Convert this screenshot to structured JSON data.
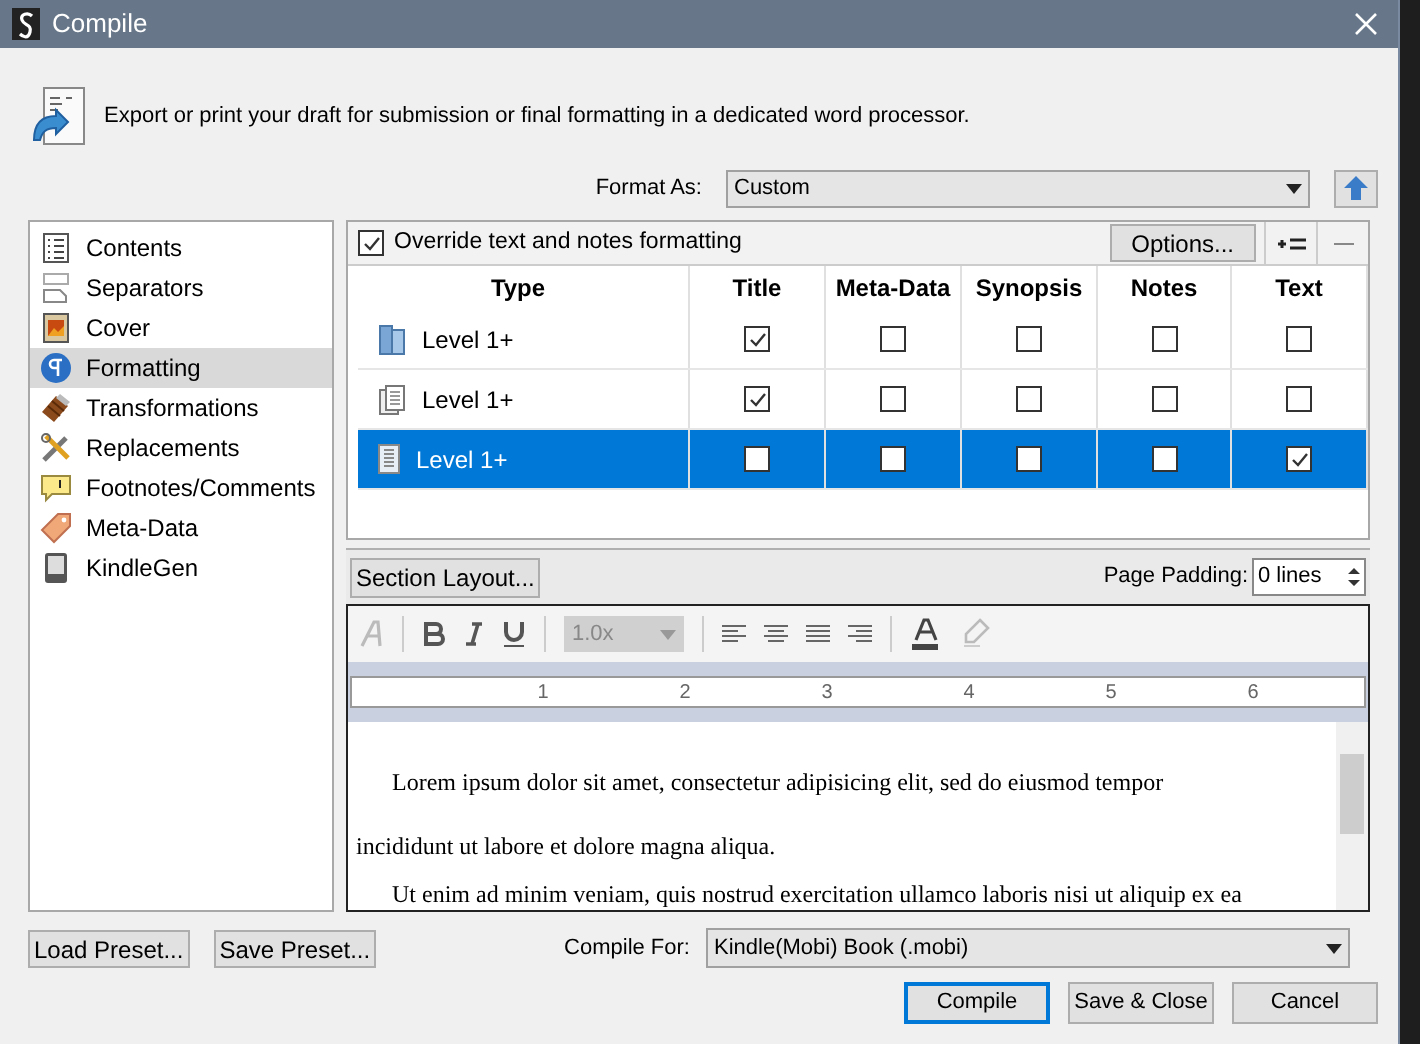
{
  "window": {
    "title": "Compile"
  },
  "header": {
    "description": "Export or print your draft for submission or final formatting in a dedicated word processor."
  },
  "format_as": {
    "label": "Format As:",
    "value": "Custom"
  },
  "sidebar": {
    "items": [
      {
        "label": "Contents",
        "selected": false
      },
      {
        "label": "Separators",
        "selected": false
      },
      {
        "label": "Cover",
        "selected": false
      },
      {
        "label": "Formatting",
        "selected": true
      },
      {
        "label": "Transformations",
        "selected": false
      },
      {
        "label": "Replacements",
        "selected": false
      },
      {
        "label": "Footnotes/Comments",
        "selected": false
      },
      {
        "label": "Meta-Data",
        "selected": false
      },
      {
        "label": "KindleGen",
        "selected": false
      }
    ]
  },
  "override": {
    "label": "Override text and notes formatting",
    "checked": true
  },
  "options_button": "Options...",
  "table": {
    "columns": [
      "Type",
      "Title",
      "Meta-Data",
      "Synopsis",
      "Notes",
      "Text"
    ],
    "rows": [
      {
        "kind": "folder",
        "type": "Level 1+",
        "selected": false,
        "flags": [
          {
            "checked": true
          },
          {
            "checked": false
          },
          {
            "checked": false
          },
          {
            "checked": false
          },
          {
            "checked": false
          }
        ]
      },
      {
        "kind": "group",
        "type": "Level 1+",
        "selected": false,
        "flags": [
          {
            "checked": true
          },
          {
            "checked": false
          },
          {
            "checked": false
          },
          {
            "checked": false
          },
          {
            "checked": false
          }
        ]
      },
      {
        "kind": "document",
        "type": "Level 1+",
        "selected": true,
        "flags": [
          {
            "checked": false
          },
          {
            "checked": false
          },
          {
            "checked": false
          },
          {
            "checked": false
          },
          {
            "checked": true
          }
        ]
      }
    ]
  },
  "section_layout_button": "Section Layout...",
  "page_padding": {
    "label": "Page Padding:",
    "value": "0 lines"
  },
  "editor": {
    "line_spacing": "1.0x",
    "ruler": [
      "1",
      "2",
      "3",
      "4",
      "5",
      "6"
    ],
    "paragraphs": [
      "Lorem ipsum dolor sit amet, consectetur adipisicing elit, sed do eiusmod tempor incididunt ut labore et dolore magna aliqua.",
      "Ut enim ad minim veniam, quis nostrud exercitation ullamco laboris nisi ut aliquip ex ea"
    ]
  },
  "load_preset": "Load Preset...",
  "save_preset": "Save Preset...",
  "compile_for": {
    "label": "Compile For:",
    "value": "Kindle(Mobi) Book (.mobi)"
  },
  "buttons": [
    {
      "label": "Compile",
      "default": true
    },
    {
      "label": "Save & Close",
      "default": false
    },
    {
      "label": "Cancel",
      "default": false
    }
  ]
}
